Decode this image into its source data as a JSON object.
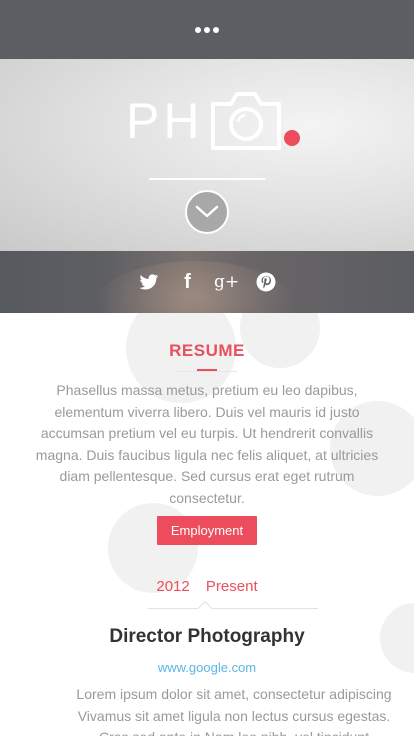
{
  "topbar": {
    "menu_icon": "more-dots-icon"
  },
  "hero": {
    "logo_text": "PH",
    "logo_icon": "camera-icon",
    "scroll_icon": "chevron-down-icon"
  },
  "social": {
    "icons": [
      "twitter-icon",
      "facebook-icon",
      "google-plus-icon",
      "pinterest-icon"
    ],
    "facebook_glyph": "f",
    "google_glyph": "g+"
  },
  "resume": {
    "title": "RESUME",
    "intro": "Phasellus massa metus, pretium eu leo dapibus, elementum viverra libero. Duis vel mauris id justo accumsan pretium vel eu turpis. Ut hendrerit convallis magna. Duis faucibus ligula nec felis aliquet, at ultricies diam pellentesque. Sed cursus erat eget rutrum consectetur.",
    "tag": "Employment",
    "year_start": "2012",
    "year_end": "Present",
    "job_title": "Director Photography",
    "job_link": "www.google.com",
    "job_desc_lines": [
      "Lorem ipsum dolor sit amet, consectetur adipiscing",
      "Vivamus sit amet ligula non lectus cursus egestas.",
      "Cras sed ante in Nam leo nibh, vel tincidunt"
    ]
  },
  "colors": {
    "accent": "#ec4c5b",
    "link": "#5bb6e4",
    "bar": "#5b5e63"
  }
}
